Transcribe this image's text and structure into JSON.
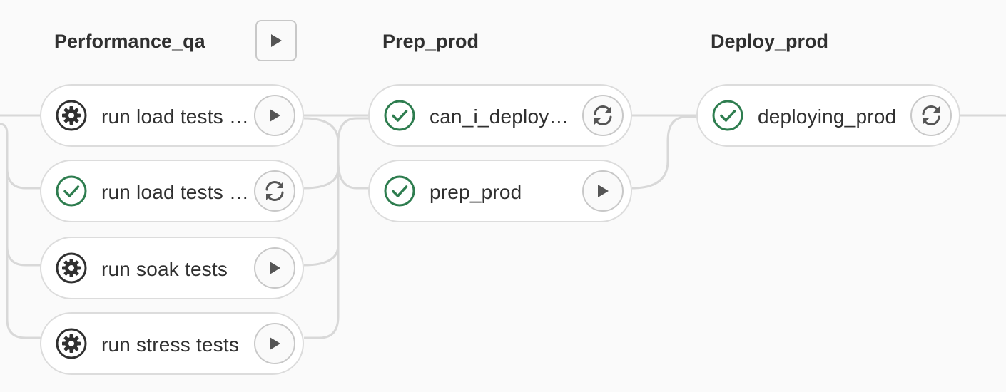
{
  "stages": [
    {
      "title": "Performance_qa",
      "stage_action": "play-icon",
      "jobs": [
        {
          "name": "run load tests …",
          "status": "manual",
          "status_icon": "gear-icon",
          "action": "play-icon"
        },
        {
          "name": "run load tests …",
          "status": "success",
          "status_icon": "check-circle-icon",
          "action": "retry-icon"
        },
        {
          "name": "run soak tests",
          "status": "manual",
          "status_icon": "gear-icon",
          "action": "play-icon"
        },
        {
          "name": "run stress tests",
          "status": "manual",
          "status_icon": "gear-icon",
          "action": "play-icon"
        }
      ]
    },
    {
      "title": "Prep_prod",
      "jobs": [
        {
          "name": "can_i_deploy_p…",
          "status": "success",
          "status_icon": "check-circle-icon",
          "action": "retry-icon"
        },
        {
          "name": "prep_prod",
          "status": "success",
          "status_icon": "check-circle-icon",
          "action": "play-icon"
        }
      ]
    },
    {
      "title": "Deploy_prod",
      "jobs": [
        {
          "name": "deploying_prod",
          "status": "success",
          "status_icon": "check-circle-icon",
          "action": "retry-icon"
        }
      ]
    }
  ],
  "colors": {
    "success": "#2e7d4f",
    "manual": "#303030",
    "action_icon": "#555555",
    "connector": "#d8d8d8",
    "job_border": "#dcdcdc",
    "background": "#fafafa"
  }
}
